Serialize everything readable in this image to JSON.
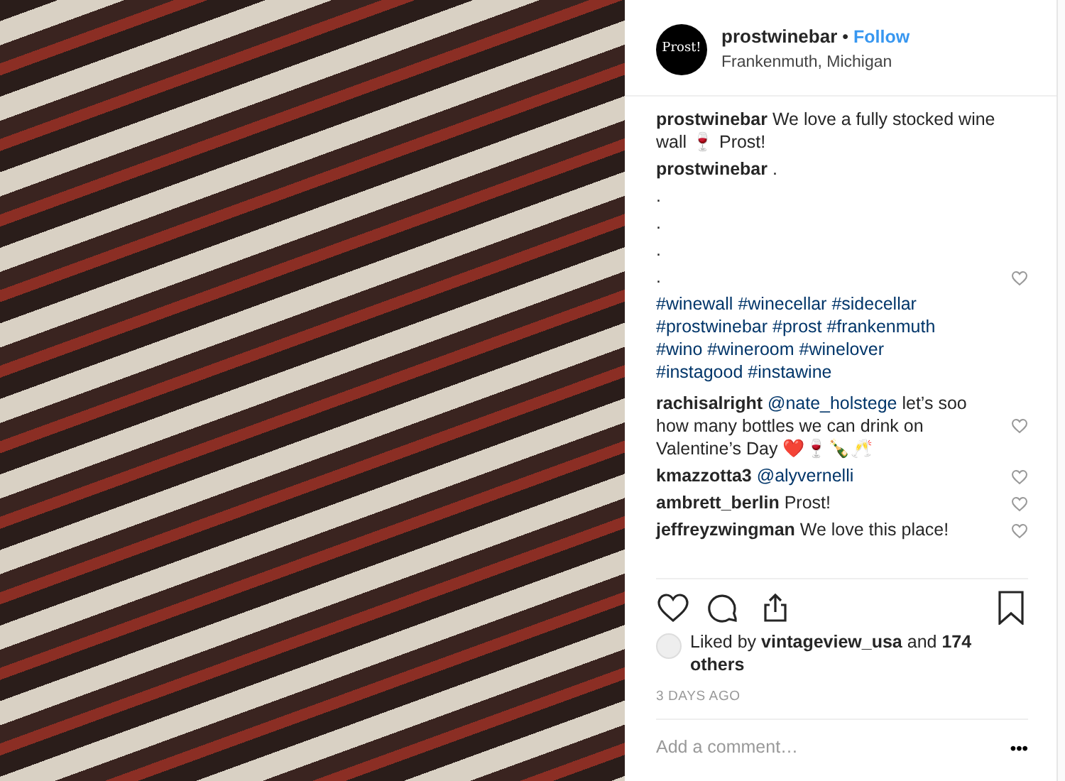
{
  "post": {
    "header": {
      "logo_text": "Prost!",
      "username": "prostwinebar",
      "separator": "•",
      "follow": "Follow",
      "location": "Frankenmuth, Michigan"
    },
    "caption": [
      {
        "user": "prostwinebar",
        "text": "We love a fully stocked wine wall 🍷 Prost!"
      },
      {
        "user": "prostwinebar",
        "text": "."
      }
    ],
    "dot_lines": [
      ".",
      ".",
      ".",
      "."
    ],
    "caption_liked": false,
    "hashtag_lines": [
      [
        "#winewall",
        "#winecellar",
        "#sidecellar"
      ],
      [
        "#prostwinebar",
        "#prost",
        "#frankenmuth"
      ],
      [
        "#wino",
        "#wineroom",
        "#winelover"
      ],
      [
        "#instagood",
        "#instawine"
      ]
    ],
    "comments": [
      {
        "user": "rachisalright",
        "mention": "@nate_holstege",
        "text": "let’s soo how many bottles we can drink on Valentine’s Day ❤️🍷🍾🥂",
        "liked": false
      },
      {
        "user": "kmazzotta3",
        "mention": "@alyvernelli",
        "liked": false
      },
      {
        "user": "ambrett_berlin",
        "text": "Prost!",
        "liked": false
      },
      {
        "user": "jeffreyzwingman",
        "text": "We love this place!",
        "liked": false
      }
    ],
    "actions": {
      "liked": false,
      "saved": false
    },
    "likes": "Liked by **vintageview_usa** and **174 others**",
    "time": "3 DAYS AGO",
    "comment_field": {
      "placeholder": "Add a comment…"
    },
    "more": "•••"
  }
}
